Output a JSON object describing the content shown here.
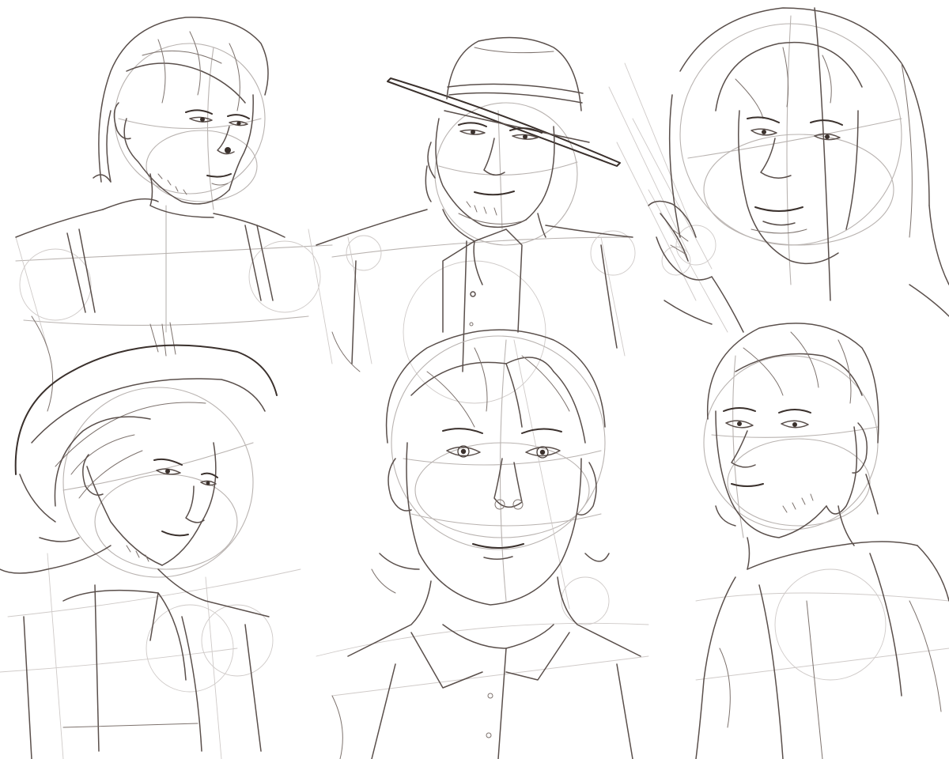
{
  "sketch_sheet": {
    "figures": [
      {
        "id": "fig-1",
        "description": "man-half-turned-suspenders"
      },
      {
        "id": "fig-2",
        "description": "man-in-flat-brim-hat-vest"
      },
      {
        "id": "fig-3",
        "description": "man-in-hood-hand-raised"
      },
      {
        "id": "fig-4",
        "description": "man-in-wide-hat-tilted-head"
      },
      {
        "id": "fig-5",
        "description": "man-front-view-collared-shirt"
      },
      {
        "id": "fig-6",
        "description": "man-three-quarter-coat"
      }
    ],
    "colors": {
      "paper": "#ffffff",
      "construction_lines": "#b9b3b0",
      "line_art": "#5a4f4b",
      "accents": "#3a302c"
    }
  }
}
